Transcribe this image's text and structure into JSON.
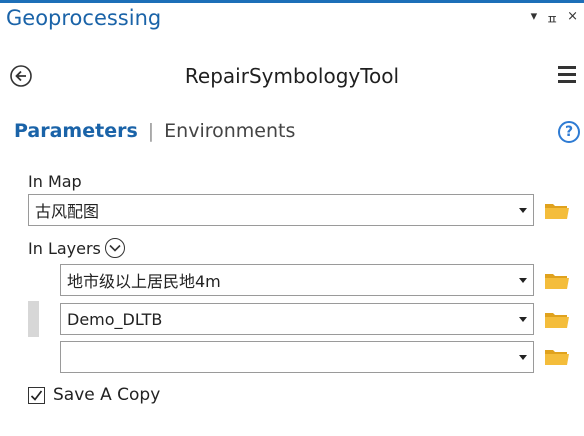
{
  "pane": {
    "title": "Geoprocessing",
    "pin_glyph": "ㅍ",
    "dropdown_glyph": "▾",
    "close_glyph": "×"
  },
  "tool": {
    "name": "RepairSymbologyTool"
  },
  "tabs": {
    "parameters": "Parameters",
    "separator": "|",
    "environments": "Environments",
    "help_glyph": "?"
  },
  "params": {
    "in_map_label": "In Map",
    "in_map_value": "古风配图",
    "in_layers_label": "In Layers",
    "layers": [
      {
        "value": "地市级以上居民地4m"
      },
      {
        "value": "Demo_DLTB"
      },
      {
        "value": ""
      }
    ],
    "save_copy_label": "Save A Copy",
    "save_copy_checked": true
  },
  "colors": {
    "accent": "#1a63a8",
    "folder": "#f0b429"
  },
  "icons": [
    "back-arrow-icon",
    "menu-icon",
    "help-icon",
    "folder-icon",
    "chevron-down-icon",
    "checkmark-icon"
  ]
}
